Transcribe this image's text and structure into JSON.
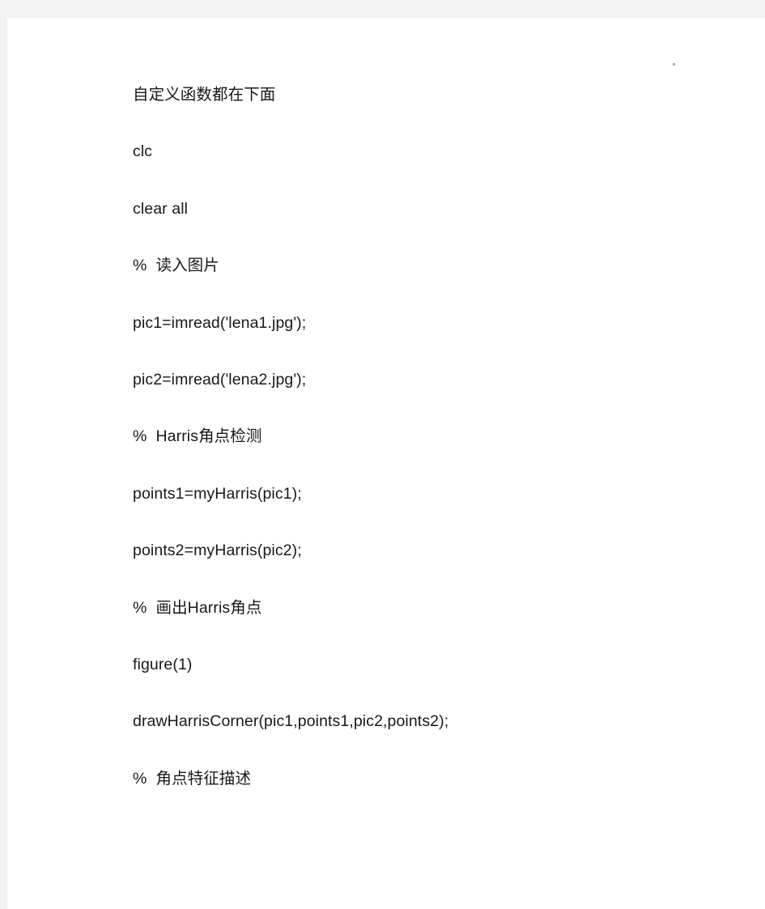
{
  "page": {
    "background_color": "#f3f3f4",
    "sheet_color": "#ffffff",
    "text_color": "#181818",
    "stray_mark_color": "#9a9a7a"
  },
  "document": {
    "lines": [
      {
        "text": "自定义函数都在下面",
        "kind": "note"
      },
      {
        "text": "clc",
        "kind": "code"
      },
      {
        "text": "clear all",
        "kind": "code"
      },
      {
        "text": "%  读入图片",
        "kind": "comment"
      },
      {
        "text": "pic1=imread('lena1.jpg');",
        "kind": "code"
      },
      {
        "text": "pic2=imread('lena2.jpg');",
        "kind": "code"
      },
      {
        "text": "%  Harris角点检测",
        "kind": "comment"
      },
      {
        "text": "points1=myHarris(pic1);",
        "kind": "code"
      },
      {
        "text": "points2=myHarris(pic2);",
        "kind": "code"
      },
      {
        "text": "%  画出Harris角点",
        "kind": "comment"
      },
      {
        "text": "figure(1)",
        "kind": "code"
      },
      {
        "text": "drawHarrisCorner(pic1,points1,pic2,points2);",
        "kind": "code"
      },
      {
        "text": "%  角点特征描述",
        "kind": "comment"
      }
    ]
  }
}
